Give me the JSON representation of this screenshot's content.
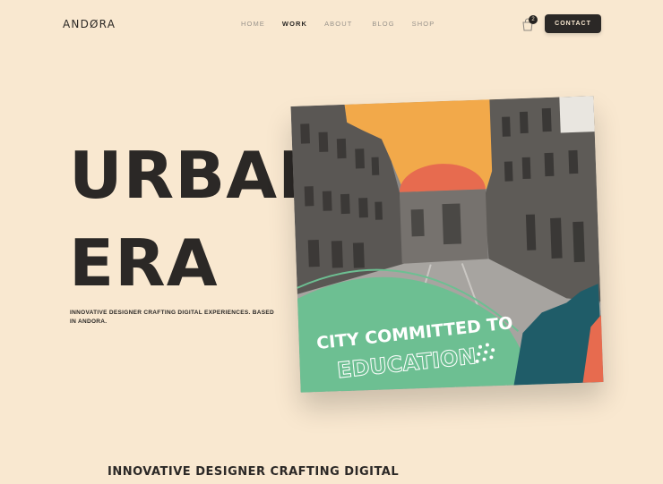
{
  "brand": {
    "logo": "ANDØRA"
  },
  "nav": {
    "items": [
      {
        "label": "HOME"
      },
      {
        "label": "WORK"
      },
      {
        "label": "ABOUT"
      },
      {
        "label": "BLOG"
      },
      {
        "label": "SHOP"
      }
    ],
    "active_label": "WORK"
  },
  "cart": {
    "count": "2",
    "icon": "shopping-bag-icon"
  },
  "contact": {
    "label": "CONTACT"
  },
  "hero": {
    "line1": "URBAN",
    "line2": "ERA",
    "tagline": "INNOVATIVE DESIGNER CRAFTING DIGITAL EXPERIENCES. BASED IN ANDORA."
  },
  "poster": {
    "line1": "CITY COMMITTED TO",
    "line2": "EDUCATION"
  },
  "section": {
    "heading": "INNOVATIVE DESIGNER CRAFTING DIGITAL"
  },
  "colors": {
    "background": "#f9e8d0",
    "ink": "#2b2826",
    "sky_orange": "#f2a94a",
    "sun_red": "#e76b4f",
    "mint": "#6dbf92",
    "teal": "#1f5c68"
  }
}
